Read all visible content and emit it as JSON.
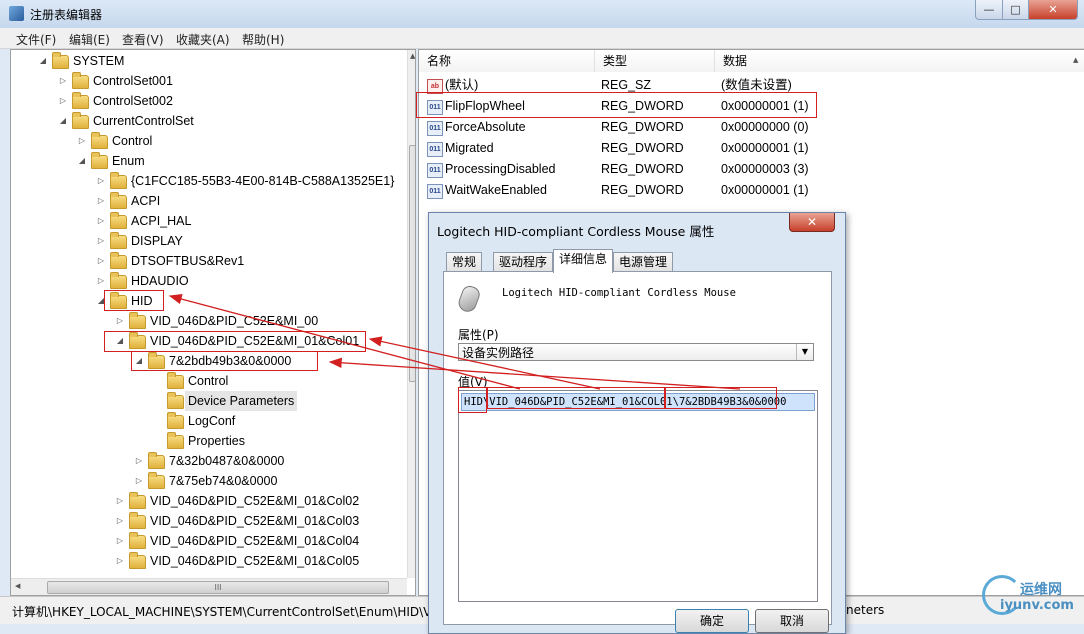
{
  "window": {
    "title": "注册表编辑器",
    "min": "—",
    "max": "□",
    "close": "✕"
  },
  "menu": [
    "文件(F)",
    "编辑(E)",
    "查看(V)",
    "收藏夹(A)",
    "帮助(H)"
  ],
  "tree": [
    {
      "label": "SYSTEM",
      "arrow": "◢"
    },
    {
      "label": "ControlSet001",
      "arrow": "▷"
    },
    {
      "label": "ControlSet002",
      "arrow": "▷"
    },
    {
      "label": "CurrentControlSet",
      "arrow": "◢"
    },
    {
      "label": "Control",
      "arrow": "▷"
    },
    {
      "label": "Enum",
      "arrow": "◢"
    },
    {
      "label": "{C1FCC185-55B3-4E00-814B-C588A13525E1}",
      "arrow": "▷"
    },
    {
      "label": "ACPI",
      "arrow": "▷"
    },
    {
      "label": "ACPI_HAL",
      "arrow": "▷"
    },
    {
      "label": "DISPLAY",
      "arrow": "▷"
    },
    {
      "label": "DTSOFTBUS&Rev1",
      "arrow": "▷"
    },
    {
      "label": "HDAUDIO",
      "arrow": "▷"
    },
    {
      "label": "HID",
      "arrow": "◢"
    },
    {
      "label": "VID_046D&PID_C52E&MI_00",
      "arrow": "▷"
    },
    {
      "label": "VID_046D&PID_C52E&MI_01&Col01",
      "arrow": "◢"
    },
    {
      "label": "7&2bdb49b3&0&0000",
      "arrow": "◢"
    },
    {
      "label": "Control",
      "arrow": ""
    },
    {
      "label": "Device Parameters",
      "arrow": ""
    },
    {
      "label": "LogConf",
      "arrow": ""
    },
    {
      "label": "Properties",
      "arrow": ""
    },
    {
      "label": "7&32b0487&0&0000",
      "arrow": "▷"
    },
    {
      "label": "7&75eb74&0&0000",
      "arrow": "▷"
    },
    {
      "label": "VID_046D&PID_C52E&MI_01&Col02",
      "arrow": "▷"
    },
    {
      "label": "VID_046D&PID_C52E&MI_01&Col03",
      "arrow": "▷"
    },
    {
      "label": "VID_046D&PID_C52E&MI_01&Col04",
      "arrow": "▷"
    },
    {
      "label": "VID_046D&PID_C52E&MI_01&Col05",
      "arrow": "▷"
    }
  ],
  "tree_hscroll_grip": "III",
  "values": {
    "headers": [
      "名称",
      "类型",
      "数据"
    ],
    "rows": [
      {
        "icon": "ab",
        "name": "(默认)",
        "type": "REG_SZ",
        "data": "(数值未设置)"
      },
      {
        "icon": "011",
        "name": "FlipFlopWheel",
        "type": "REG_DWORD",
        "data": "0x00000001 (1)"
      },
      {
        "icon": "011",
        "name": "ForceAbsolute",
        "type": "REG_DWORD",
        "data": "0x00000000 (0)"
      },
      {
        "icon": "011",
        "name": "Migrated",
        "type": "REG_DWORD",
        "data": "0x00000001 (1)"
      },
      {
        "icon": "011",
        "name": "ProcessingDisabled",
        "type": "REG_DWORD",
        "data": "0x00000003 (3)"
      },
      {
        "icon": "011",
        "name": "WaitWakeEnabled",
        "type": "REG_DWORD",
        "data": "0x00000001 (1)"
      }
    ]
  },
  "status_left": "计算机\\HKEY_LOCAL_MACHINE\\SYSTEM\\CurrentControlSet\\Enum\\HID\\V",
  "status_right": "neters",
  "dialog": {
    "title": "Logitech HID-compliant Cordless Mouse 属性",
    "close": "✕",
    "tabs": [
      "常规",
      "驱动程序",
      "详细信息",
      "电源管理"
    ],
    "device_name": "Logitech HID-compliant Cordless Mouse",
    "property_label": "属性(P)",
    "property_value": "设备实例路径",
    "value_label": "值(V)",
    "value_parts": [
      "HID",
      "\\VID_046D&PID_C52E&MI_01&COL01",
      "\\7&2BDB49B3&0&0000"
    ],
    "ok": "确定",
    "cancel": "取消"
  },
  "watermark": {
    "cn": "运维网",
    "url": "iyunv.com"
  },
  "colors": {
    "annotation_red": "#d21f1f",
    "folder": "#e9c25a"
  }
}
